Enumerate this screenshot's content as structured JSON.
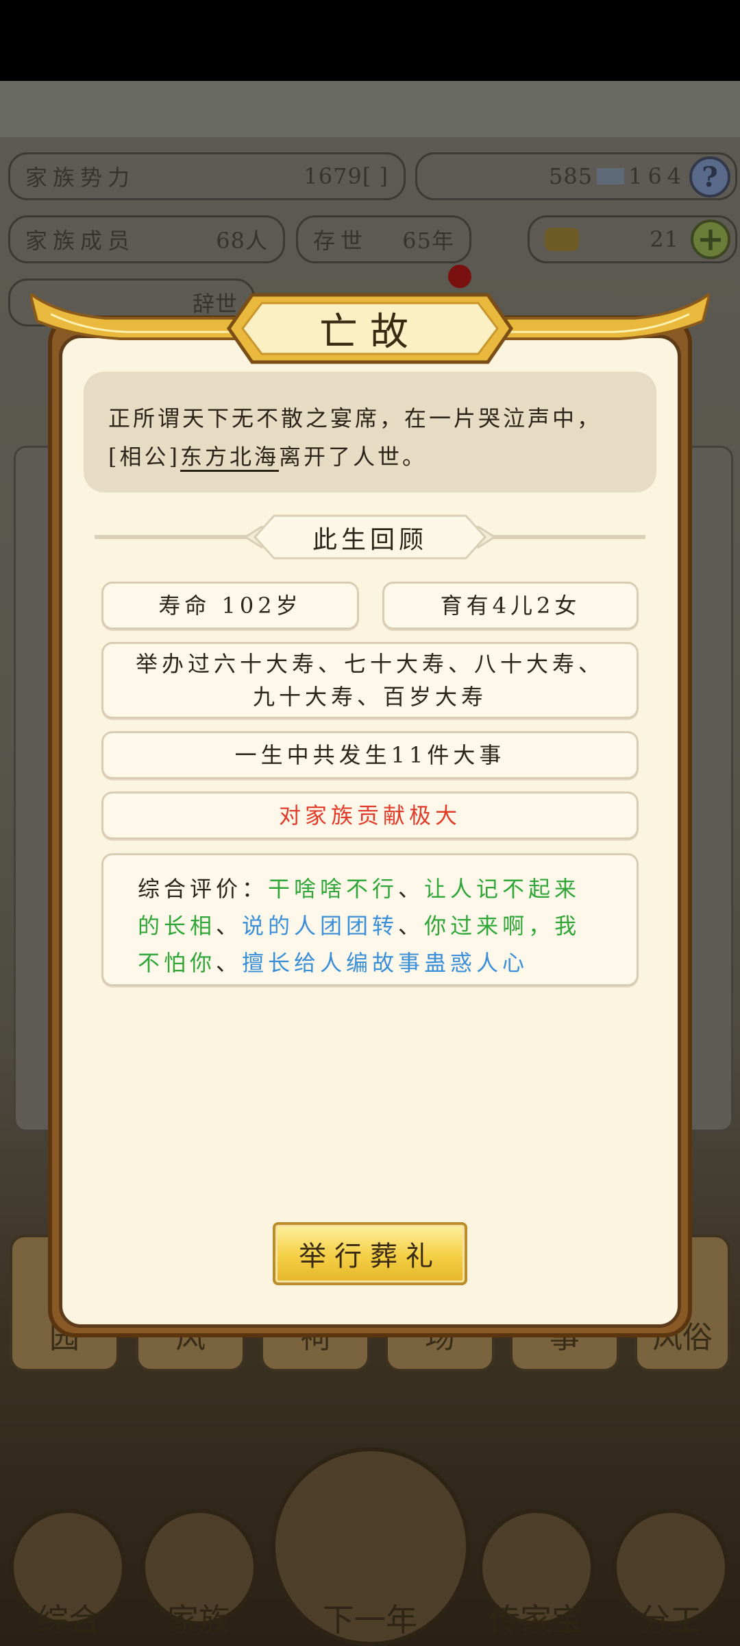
{
  "background": {
    "stats": {
      "family_power_label": "家族势力",
      "family_power_value": "1679",
      "family_power_suffix": "[    ]",
      "members_label": "家族成员",
      "members_value": "68人",
      "years_label": "存世",
      "years_value": "65年",
      "silver": "585",
      "coins": "164",
      "gold": "21",
      "third_row_label": "",
      "third_row_value": "辞世"
    },
    "help_icon": "?",
    "plus_icon": "+",
    "tabs": [
      "园",
      "风",
      "祠",
      "场",
      "事",
      "风俗"
    ],
    "nav": [
      "综合",
      "家族",
      "下一年",
      "传家宝",
      "分工"
    ]
  },
  "dialog": {
    "title": "亡故",
    "message_prefix": "正所谓天下无不散之宴席，在一片哭泣声中，[相公]",
    "deceased_name": "东方北海",
    "message_suffix": "离开了人世。",
    "section_title": "此生回顾",
    "lifespan": "寿命 102岁",
    "children": "育有4儿2女",
    "birthdays": "举办过六十大寿、七十大寿、八十大寿、九十大寿、百岁大寿",
    "events": "一生中共发生11件大事",
    "contribution": "对家族贡献极大",
    "evaluation": {
      "label": "综合评价：",
      "trait1": "干啥啥不行",
      "sep1": "、",
      "trait2": "让人记不起来的长相",
      "sep2": "、",
      "trait3": "说的人团团转",
      "sep3": "、",
      "trait4": "你过来啊，我不怕你",
      "sep4": "、",
      "trait5": "擅长给人编故事蛊惑人心"
    },
    "action_button": "举行葬礼"
  },
  "colors": {
    "modal_bg": "#fbf5df",
    "message_bg": "#e6dbc3",
    "green_trait": "#2fa637",
    "blue_trait": "#3b8fd9",
    "red_text": "#e23b2a",
    "button_gold": "#f4cf44"
  }
}
